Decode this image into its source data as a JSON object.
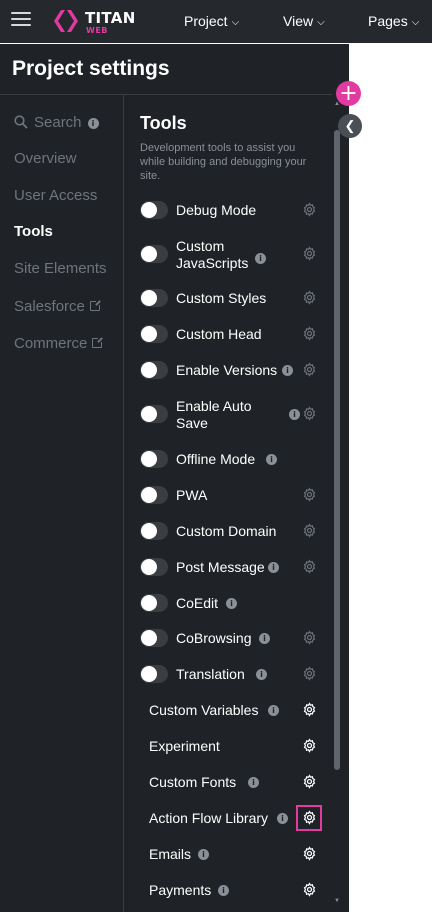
{
  "header": {
    "logo_text": "TITAN",
    "logo_sub": "WEB",
    "menus": [
      "Project",
      "View",
      "Pages"
    ]
  },
  "panel": {
    "title": "Project settings",
    "nav": {
      "search": "Search",
      "items": [
        "Overview",
        "User Access",
        "Tools",
        "Site Elements",
        "Salesforce",
        "Commerce"
      ],
      "active": "Tools"
    },
    "tools": {
      "title": "Tools",
      "description": "Development tools to assist you while building and debugging your site.",
      "toggle_rows": [
        {
          "label": "Debug Mode",
          "info": false,
          "gear": true,
          "on": false
        },
        {
          "label": "Custom JavaScripts",
          "info": true,
          "gear": true,
          "on": false
        },
        {
          "label": "Custom Styles",
          "info": false,
          "gear": true,
          "on": false
        },
        {
          "label": "Custom Head",
          "info": false,
          "gear": true,
          "on": false
        },
        {
          "label": "Enable Versions",
          "info": true,
          "gear": true,
          "on": false
        },
        {
          "label": "Enable Auto Save",
          "info": true,
          "gear": true,
          "on": false
        },
        {
          "label": "Offline Mode",
          "info": true,
          "gear": false,
          "on": false
        },
        {
          "label": "PWA",
          "info": false,
          "gear": true,
          "on": false
        },
        {
          "label": "Custom Domain",
          "info": false,
          "gear": true,
          "on": false
        },
        {
          "label": "Post Message",
          "info": true,
          "gear": true,
          "on": false
        },
        {
          "label": "CoEdit",
          "info": true,
          "gear": false,
          "on": false
        },
        {
          "label": "CoBrowsing",
          "info": true,
          "gear": true,
          "on": false
        },
        {
          "label": "Translation",
          "info": true,
          "gear": true,
          "on": false
        }
      ],
      "settings_rows": [
        {
          "label": "Custom Variables",
          "info": true
        },
        {
          "label": "Experiment",
          "info": false
        },
        {
          "label": "Custom Fonts",
          "info": true
        },
        {
          "label": "Action Flow Library",
          "info": true,
          "highlighted": true
        },
        {
          "label": "Emails",
          "info": true
        },
        {
          "label": "Payments",
          "info": true
        }
      ]
    }
  },
  "colors": {
    "topbar_bg": "#25282c",
    "panel_bg": "#1f2226",
    "accent": "#e13ba2",
    "nav_inactive": "#6f757c"
  },
  "icons": [
    "hamburger-icon",
    "titan-logo-icon",
    "chevron-down-icon",
    "search-icon",
    "info-icon",
    "external-link-icon",
    "gear-icon",
    "plus-icon",
    "chevron-left-icon"
  ]
}
